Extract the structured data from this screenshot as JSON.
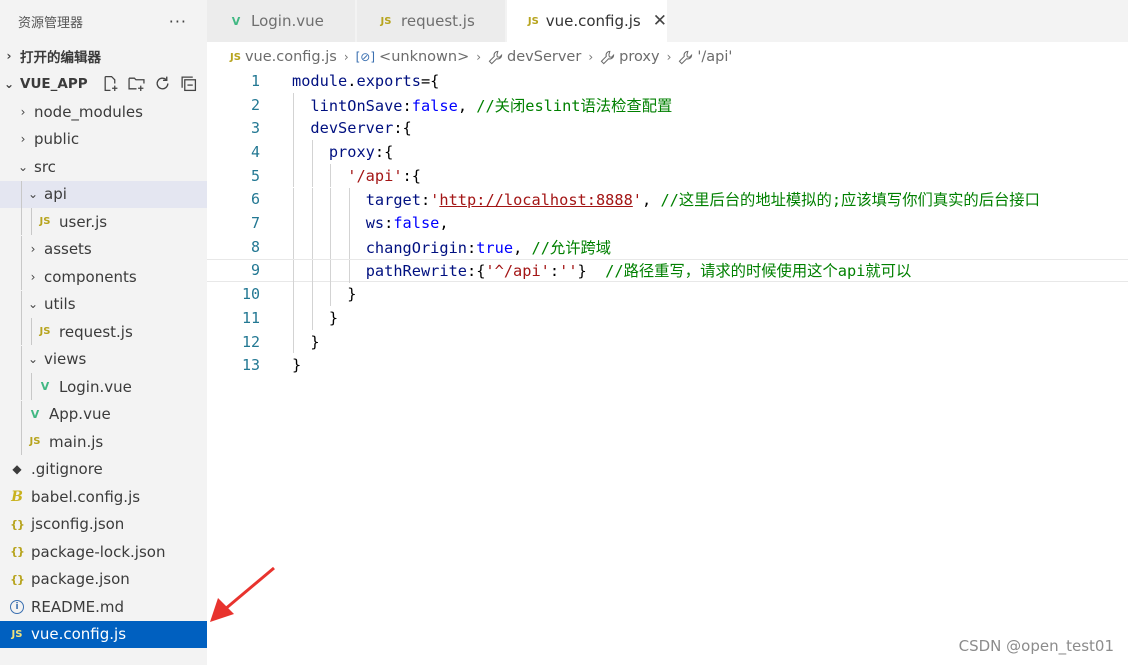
{
  "explorer": {
    "title": "资源管理器",
    "more": "···",
    "sections": {
      "open_editors": "打开的编辑器",
      "project": "VUE_APP"
    },
    "tree": [
      {
        "label": "node_modules",
        "chev": "›",
        "depth": 1,
        "icon": ""
      },
      {
        "label": "public",
        "chev": "›",
        "depth": 1,
        "icon": ""
      },
      {
        "label": "src",
        "chev": "⌄",
        "depth": 1,
        "icon": ""
      },
      {
        "label": "api",
        "chev": "⌄",
        "depth": 2,
        "icon": ""
      },
      {
        "label": "user.js",
        "chev": "",
        "depth": 3,
        "icon": "JS"
      },
      {
        "label": "assets",
        "chev": "›",
        "depth": 2,
        "icon": ""
      },
      {
        "label": "components",
        "chev": "›",
        "depth": 2,
        "icon": ""
      },
      {
        "label": "utils",
        "chev": "⌄",
        "depth": 2,
        "icon": ""
      },
      {
        "label": "request.js",
        "chev": "",
        "depth": 3,
        "icon": "JS"
      },
      {
        "label": "views",
        "chev": "⌄",
        "depth": 2,
        "icon": ""
      },
      {
        "label": "Login.vue",
        "chev": "",
        "depth": 3,
        "icon": "V"
      },
      {
        "label": "App.vue",
        "chev": "",
        "depth": 2,
        "icon": "V"
      },
      {
        "label": "main.js",
        "chev": "",
        "depth": 2,
        "icon": "JS"
      },
      {
        "label": ".gitignore",
        "chev": "",
        "depth": 0,
        "icon": "◆"
      },
      {
        "label": "babel.config.js",
        "chev": "",
        "depth": 0,
        "icon": "B"
      },
      {
        "label": "jsconfig.json",
        "chev": "",
        "depth": 0,
        "icon": "{}"
      },
      {
        "label": "package-lock.json",
        "chev": "",
        "depth": 0,
        "icon": "{}"
      },
      {
        "label": "package.json",
        "chev": "",
        "depth": 0,
        "icon": "{}"
      },
      {
        "label": "README.md",
        "chev": "",
        "depth": 0,
        "icon": "i"
      },
      {
        "label": "vue.config.js",
        "chev": "",
        "depth": 0,
        "icon": "JS"
      }
    ],
    "action_icons": [
      "new-file-icon",
      "new-folder-icon",
      "refresh-icon",
      "collapse-all-icon"
    ]
  },
  "tabs": [
    {
      "label": "Login.vue",
      "icon": "V"
    },
    {
      "label": "request.js",
      "icon": "JS"
    },
    {
      "label": "vue.config.js",
      "icon": "JS",
      "close": "✕"
    }
  ],
  "breadcrumb": {
    "file": "vue.config.js",
    "file_icon": "JS",
    "unknown_icon": "[⊘]",
    "unknown": "<unknown>",
    "dev_server": "devServer",
    "proxy": "proxy",
    "api": "'/api'",
    "sep": "›",
    "wrench": "🔧"
  },
  "code": [
    {
      "n": "1",
      "tokens": [
        [
          "t-var",
          "module"
        ],
        [
          "",
          "."
        ],
        [
          "t-var",
          "exports"
        ],
        [
          "",
          "={"
        ]
      ]
    },
    {
      "n": "2",
      "tokens": [
        [
          "",
          "  "
        ],
        [
          "t-prop",
          "lintOnSave"
        ],
        [
          "",
          ":"
        ],
        [
          "t-kw",
          "false"
        ],
        [
          "",
          ", "
        ],
        [
          "t-com",
          "//关闭eslint语法检查配置"
        ]
      ]
    },
    {
      "n": "3",
      "tokens": [
        [
          "",
          "  "
        ],
        [
          "t-prop",
          "devServer"
        ],
        [
          "",
          ":{"
        ]
      ]
    },
    {
      "n": "4",
      "tokens": [
        [
          "",
          "    "
        ],
        [
          "t-prop",
          "proxy"
        ],
        [
          "",
          ":{"
        ]
      ]
    },
    {
      "n": "5",
      "tokens": [
        [
          "",
          "      "
        ],
        [
          "t-str",
          "'/api'"
        ],
        [
          "",
          ":{"
        ]
      ]
    },
    {
      "n": "6",
      "tokens": [
        [
          "",
          "        "
        ],
        [
          "t-prop",
          "target"
        ],
        [
          "",
          ":"
        ],
        [
          "t-str",
          "'"
        ],
        [
          "t-url",
          "http://localhost:8888"
        ],
        [
          "t-str",
          "'"
        ],
        [
          "",
          ", "
        ],
        [
          "t-com",
          "//这里后台的地址模拟的;应该填写你们真实的后台接口"
        ]
      ]
    },
    {
      "n": "7",
      "tokens": [
        [
          "",
          "        "
        ],
        [
          "t-prop",
          "ws"
        ],
        [
          "",
          ":"
        ],
        [
          "t-kw",
          "false"
        ],
        [
          "",
          ","
        ]
      ]
    },
    {
      "n": "8",
      "tokens": [
        [
          "",
          "        "
        ],
        [
          "t-prop",
          "changOrigin"
        ],
        [
          "",
          ":"
        ],
        [
          "t-kw",
          "true"
        ],
        [
          "",
          ", "
        ],
        [
          "t-com",
          "//允许跨域"
        ]
      ]
    },
    {
      "n": "9",
      "tokens": [
        [
          "",
          "        "
        ],
        [
          "t-prop",
          "pathRewrite"
        ],
        [
          "",
          ":{"
        ],
        [
          "t-str",
          "'^/api'"
        ],
        [
          "",
          ":"
        ],
        [
          "t-str",
          "''"
        ],
        [
          "",
          "}  "
        ],
        [
          "t-com",
          "//路径重写，请求的时候使用这个api就可以"
        ]
      ]
    },
    {
      "n": "10",
      "tokens": [
        [
          "",
          "      }"
        ]
      ]
    },
    {
      "n": "11",
      "tokens": [
        [
          "",
          "    }"
        ]
      ]
    },
    {
      "n": "12",
      "tokens": [
        [
          "",
          "  }"
        ]
      ]
    },
    {
      "n": "13",
      "tokens": [
        [
          "",
          "}"
        ]
      ]
    }
  ],
  "watermark": "CSDN @open_test01"
}
